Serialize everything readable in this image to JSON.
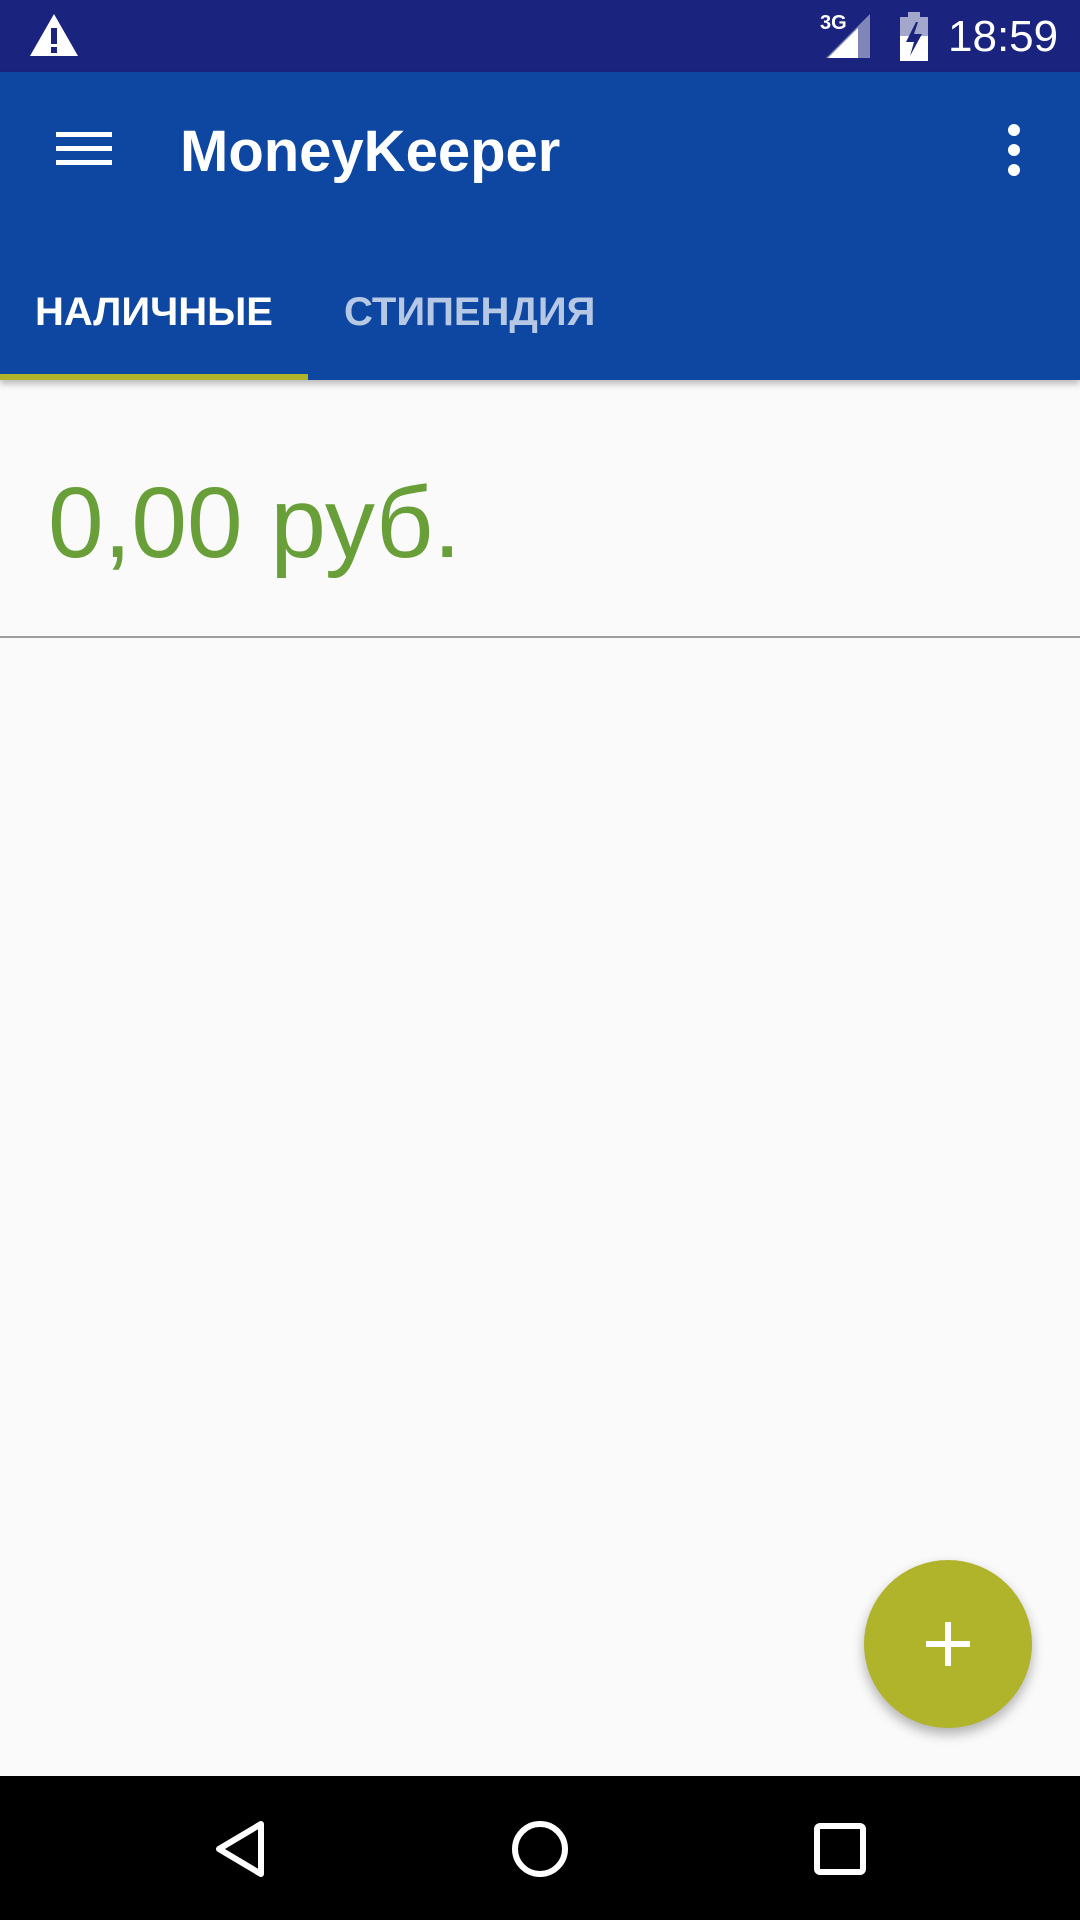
{
  "status_bar": {
    "network_label": "3G",
    "time": "18:59",
    "icons": [
      "warning-icon",
      "signal-icon",
      "battery-charging-icon"
    ]
  },
  "app_bar": {
    "title": "MoneyKeeper",
    "menu_icon": "hamburger-menu-icon",
    "overflow_icon": "more-vert-icon",
    "color": "#0d47a1"
  },
  "tabs": [
    {
      "label": "НАЛИЧНЫЕ",
      "selected": true
    },
    {
      "label": "СТИПЕНДИЯ",
      "selected": false
    }
  ],
  "main": {
    "balance": "0,00 руб.",
    "balance_color": "#689f38"
  },
  "fab": {
    "icon": "plus-icon",
    "color": "#afb42b"
  },
  "nav_bar": {
    "icons": [
      "back-icon",
      "home-icon",
      "recents-icon"
    ]
  }
}
